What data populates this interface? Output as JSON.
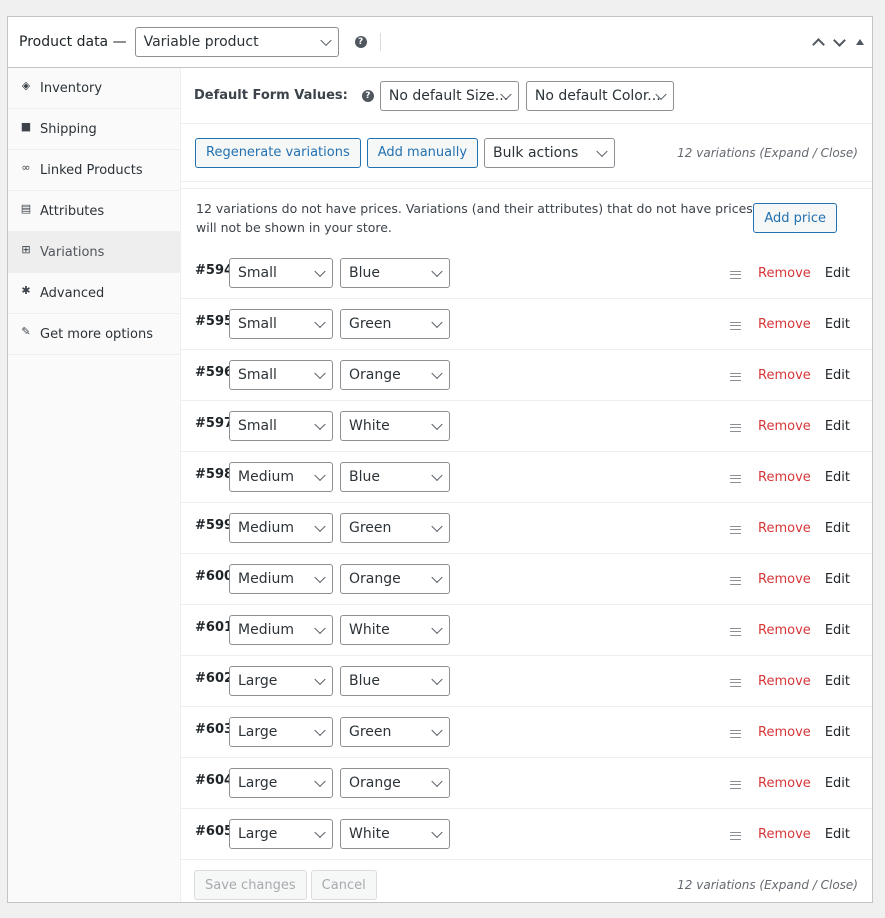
{
  "header": {
    "title": "Product data —",
    "product_type": "Variable product",
    "help_icon": "question-circle-icon",
    "actions": [
      "move-up-icon",
      "move-down-icon",
      "toggle-panel-icon"
    ]
  },
  "sidebar": {
    "items": [
      {
        "label": "Inventory",
        "icon": "tag-icon",
        "glyph": "◈"
      },
      {
        "label": "Shipping",
        "icon": "truck-icon",
        "glyph": "■"
      },
      {
        "label": "Linked Products",
        "icon": "link-icon",
        "glyph": "∞"
      },
      {
        "label": "Attributes",
        "icon": "list-view-icon",
        "glyph": "▤"
      },
      {
        "label": "Variations",
        "icon": "grid-icon",
        "glyph": "⊞"
      },
      {
        "label": "Advanced",
        "icon": "gear-icon",
        "glyph": "✱"
      },
      {
        "label": "Get more options",
        "icon": "plugin-icon",
        "glyph": "✎"
      }
    ],
    "active": "Variations"
  },
  "defaults": {
    "label": "Default Form Values:",
    "size_select": "No default Size...",
    "color_select": "No default Color..."
  },
  "toolbar": {
    "regenerate_label": "Regenerate variations",
    "add_manually_label": "Add manually",
    "bulk_actions": "Bulk actions",
    "count_text": "12 variations (Expand / Close)"
  },
  "notice": {
    "text": "12 variations do not have prices. Variations (and their attributes) that do not have prices will not be shown in your store.",
    "add_price_label": "Add price"
  },
  "variations": [
    {
      "id": "#594",
      "size": "Small",
      "color": "Blue"
    },
    {
      "id": "#595",
      "size": "Small",
      "color": "Green"
    },
    {
      "id": "#596",
      "size": "Small",
      "color": "Orange"
    },
    {
      "id": "#597",
      "size": "Small",
      "color": "White"
    },
    {
      "id": "#598",
      "size": "Medium",
      "color": "Blue"
    },
    {
      "id": "#599",
      "size": "Medium",
      "color": "Green"
    },
    {
      "id": "#600",
      "size": "Medium",
      "color": "Orange"
    },
    {
      "id": "#601",
      "size": "Medium",
      "color": "White"
    },
    {
      "id": "#602",
      "size": "Large",
      "color": "Blue"
    },
    {
      "id": "#603",
      "size": "Large",
      "color": "Green"
    },
    {
      "id": "#604",
      "size": "Large",
      "color": "Orange"
    },
    {
      "id": "#605",
      "size": "Large",
      "color": "White"
    }
  ],
  "row_actions": {
    "remove": "Remove",
    "edit": "Edit"
  },
  "footer": {
    "save_label": "Save changes",
    "cancel_label": "Cancel",
    "count_text": "12 variations (Expand / Close)"
  },
  "colors": {
    "accent": "#2271b1",
    "danger": "#d63638"
  }
}
